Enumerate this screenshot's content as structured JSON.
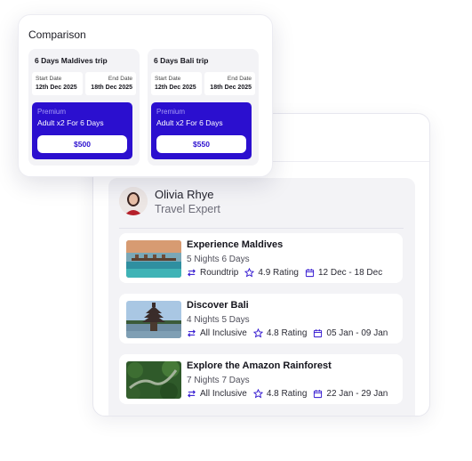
{
  "comparison": {
    "title": "Comparison",
    "trips": [
      {
        "name": "6 Days Maldives trip",
        "start_label": "Start Date",
        "start_value": "12th Dec 2025",
        "end_label": "End Date",
        "end_value": "18th Dec 2025",
        "tier": "Premium",
        "description": "Adult x2 For 6 Days",
        "price": "$500"
      },
      {
        "name": "6 Days Bali trip",
        "start_label": "Start Date",
        "start_value": "12th Dec 2025",
        "end_label": "End Date",
        "end_value": "18th Dec 2025",
        "tier": "Premium",
        "description": "Adult x2 For 6 Days",
        "price": "$550"
      }
    ]
  },
  "expert": {
    "name": "Olivia Rhye",
    "role": "Travel Expert"
  },
  "packages": [
    {
      "title": "Experience Maldives",
      "duration": "5 Nights 6 Days",
      "type": "Roundtrip",
      "rating": "4.9 Rating",
      "dates": "12 Dec - 18 Dec",
      "image": "maldives-villas-image"
    },
    {
      "title": "Discover Bali",
      "duration": "4 Nights 5 Days",
      "type": "All Inclusive",
      "rating": "4.8 Rating",
      "dates": "05 Jan - 09 Jan",
      "image": "bali-temple-image"
    },
    {
      "title": "Explore the Amazon Rainforest",
      "duration": "7 Nights 7 Days",
      "type": "All Inclusive",
      "rating": "4.8 Rating",
      "dates": "22 Jan - 29 Jan",
      "image": "amazon-river-image"
    }
  ],
  "colors": {
    "accent": "#2b0fcf",
    "icon": "#2b0fcf",
    "panel_bg": "#f3f3f6"
  },
  "icons": {
    "type": "swap-arrows-icon",
    "rating": "star-icon",
    "dates": "calendar-icon"
  }
}
